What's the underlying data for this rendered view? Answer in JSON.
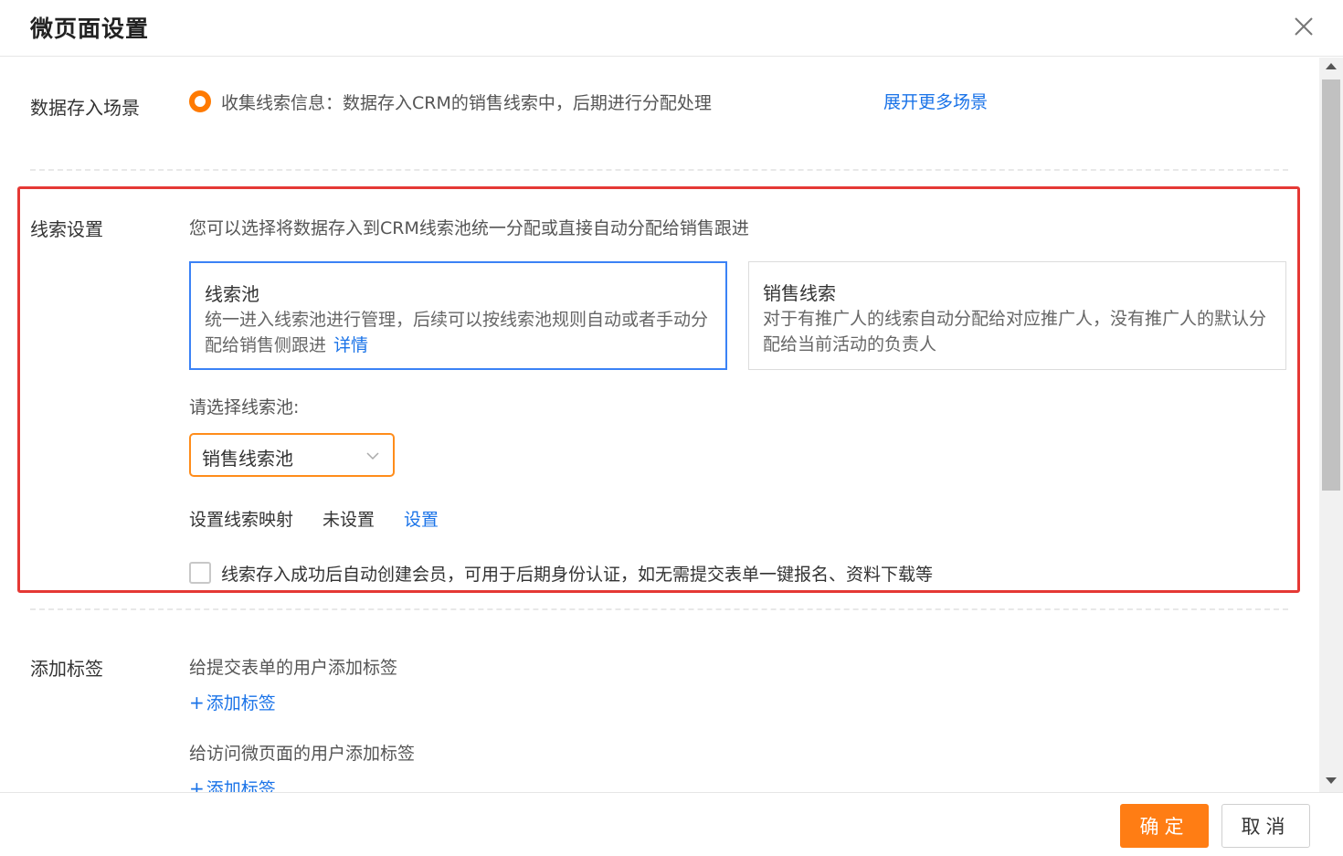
{
  "dialog": {
    "title": "微页面设置",
    "close_icon": "close-icon"
  },
  "scene": {
    "label": "数据存入场景",
    "option": "收集线索信息：数据存入CRM的销售线索中，后期进行分配处理",
    "expand_link": "展开更多场景",
    "selected": true
  },
  "lead": {
    "label": "线索设置",
    "description": "您可以选择将数据存入到CRM线索池统一分配或直接自动分配给销售跟进",
    "cards": [
      {
        "title": "线索池",
        "desc": "统一进入线索池进行管理，后续可以按线索池规则自动或者手动分配给销售侧跟进",
        "link": "详情",
        "selected": true
      },
      {
        "title": "销售线索",
        "desc": "对于有推广人的线索自动分配给对应推广人，没有推广人的默认分配给当前活动的负责人",
        "selected": false
      }
    ],
    "pool_label": "请选择线索池:",
    "pool_value": "销售线索池",
    "mapping_label": "设置线索映射",
    "mapping_status": "未设置",
    "mapping_link": "设置",
    "auto_member_label": "线索存入成功后自动创建会员，可用于后期身份认证，如无需提交表单一键报名、资料下载等",
    "auto_member_checked": false
  },
  "tags": {
    "label": "添加标签",
    "submit_desc": "给提交表单的用户添加标签",
    "add_tag_link": "添加标签",
    "visit_desc": "给访问微页面的用户添加标签",
    "add_tag_link_2": "添加标签"
  },
  "footer": {
    "ok_label": "确定",
    "cancel_label": "取消"
  },
  "colors": {
    "accent": "#ff7d14",
    "link": "#1a73e8",
    "selected_border": "#3b82f6",
    "highlight": "#e53935"
  }
}
